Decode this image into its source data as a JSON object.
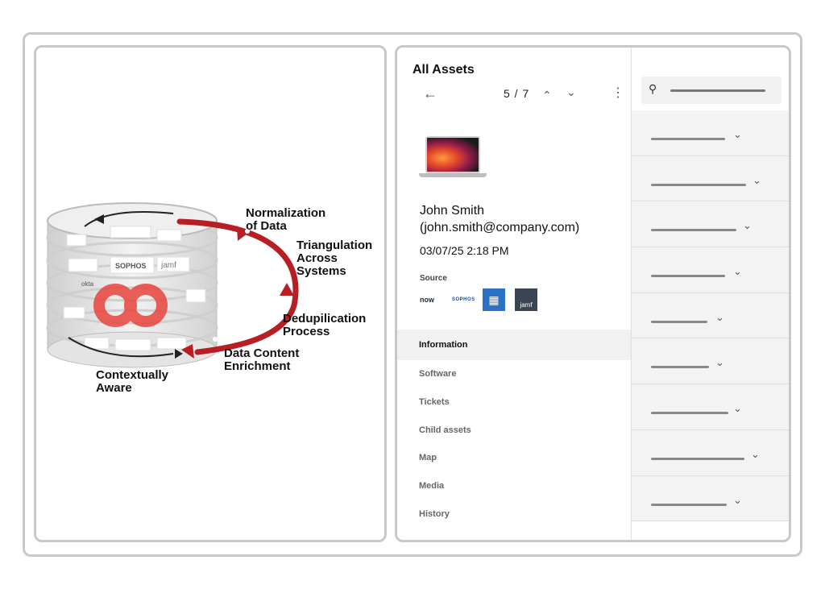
{
  "diagram": {
    "steps": [
      {
        "id": "normalization",
        "label": "Normalization\nof Data"
      },
      {
        "id": "triangulation",
        "label": "Triangulation\nAcross\nSystems"
      },
      {
        "id": "dedup",
        "label": "Dedupilication\nProcess"
      },
      {
        "id": "enrichment",
        "label": "Data Content\nEnrichment"
      },
      {
        "id": "context",
        "label": "Contextually\nAware"
      }
    ],
    "cylinder_logos": [
      "SOPHOS",
      "jamf",
      "okta"
    ],
    "arrow_color": "#b81f24",
    "brand_color": "#e8453c"
  },
  "asset_panel": {
    "title": "All Assets",
    "pager": "5 / 7",
    "icons": {
      "back": "arrow-left-icon",
      "prev": "chevron-up-icon",
      "next": "chevron-down-icon",
      "more": "more-vert-icon"
    },
    "user_name": "John Smith",
    "user_email": "(john.smith@company.com)",
    "timestamp": "03/07/25  2:18 PM",
    "source_label": "Source",
    "sources": [
      "now",
      "SOPHOS",
      "jamf"
    ],
    "nav": [
      "Information",
      "Software",
      "Tickets",
      "Child assets",
      "Map",
      "Media",
      "History"
    ],
    "active_nav": "Information"
  },
  "list_panel": {
    "search_icon": "search-icon",
    "row_count": 9
  }
}
